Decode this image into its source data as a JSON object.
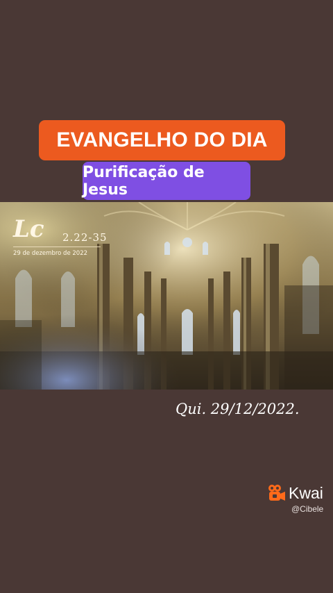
{
  "header": {
    "title": "EVANGELHO DO DIA",
    "subtitle": "Purificação de Jesus"
  },
  "hero": {
    "scripture_book": "Lc",
    "scripture_verses": "2.22-35",
    "scripture_date": "29 de dezembro de 2022"
  },
  "date_caption": "Qui. 29/12/2022.",
  "watermark": {
    "brand": "Kwai",
    "handle": "@Cibele",
    "icon": "kwai-camera-icon"
  },
  "colors": {
    "background": "#4a3835",
    "title_pill": "#ec5a1f",
    "subtitle_pill": "#7f4fe3",
    "kwai_orange": "#ff6a1a"
  }
}
